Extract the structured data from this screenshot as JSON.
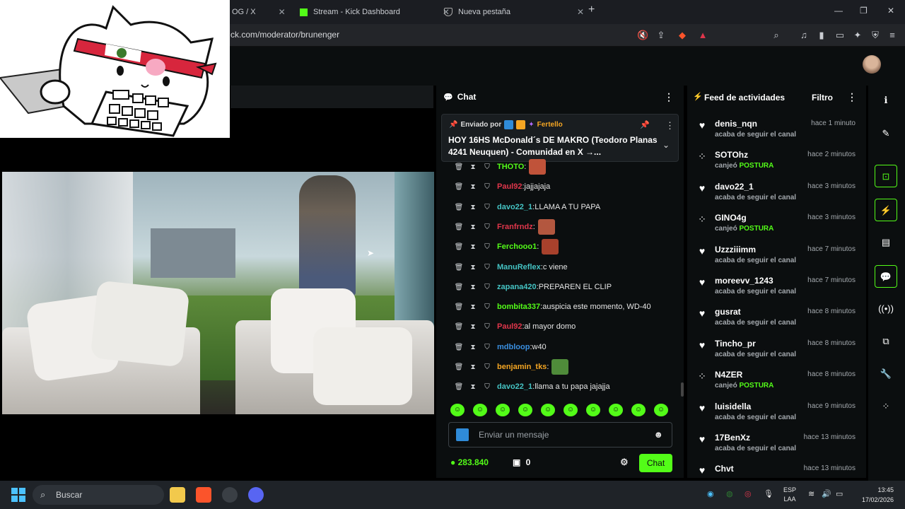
{
  "browser": {
    "tabs": [
      {
        "label": "OG / X"
      },
      {
        "label": "Stream - Kick Dashboard"
      },
      {
        "label": "Nueva pestaña"
      }
    ],
    "url": "ck.com/moderator/brunenger",
    "shield_count": "2"
  },
  "chat": {
    "title": "Chat",
    "pinned": {
      "prefix": "Enviado por",
      "user": "Fertello",
      "message": "HOY 16HS McDonald´s DE MAKRO (Teodoro Planas 4241 Neuquen) - Comunidad en X →..."
    },
    "messages": [
      {
        "user": "THOTO",
        "sep": ":",
        "text": "",
        "color": "#53fc18",
        "emote": true,
        "emote_color": "#c0533a"
      },
      {
        "user": "Paul92",
        "sep": ":",
        "text": " jajjajaja",
        "color": "#e0364b",
        "emote": false
      },
      {
        "user": "davo22_1",
        "sep": ":",
        "text": " LLAMA A TU PAPA",
        "color": "#45c4c4",
        "emote": false
      },
      {
        "user": "Franfrndz",
        "sep": ":",
        "text": "",
        "color": "#e0364b",
        "emote": true,
        "emote_color": "#b3573f"
      },
      {
        "user": "Ferchooo1",
        "sep": ":",
        "text": "",
        "color": "#53fc18",
        "emote": true,
        "emote_color": "#a8412c"
      },
      {
        "user": "ManuReflex",
        "sep": ":",
        "text": " c viene",
        "color": "#45c4c4",
        "emote": false
      },
      {
        "user": "zapana420",
        "sep": ":",
        "text": " PREPAREN EL CLIP",
        "color": "#45c4c4",
        "emote": false
      },
      {
        "user": "bombita337",
        "sep": ":",
        "text": " auspicia este momento, WD-40",
        "color": "#53fc18",
        "emote": false
      },
      {
        "user": "Paul92",
        "sep": ":",
        "text": " al mayor domo",
        "color": "#e0364b",
        "emote": false
      },
      {
        "user": "mdbloop",
        "sep": ":",
        "text": " w40",
        "color": "#3a8fe0",
        "emote": false
      },
      {
        "user": "benjamin_tks",
        "sep": ":",
        "text": "",
        "color": "#f5a623",
        "emote": true,
        "emote_color": "#4f8b3a"
      },
      {
        "user": "davo22_1",
        "sep": ":",
        "text": " llama a tu papa jajajja",
        "color": "#45c4c4",
        "emote": false
      }
    ],
    "input_placeholder": "Enviar un mensaje",
    "points": "283.840",
    "store_count": "0",
    "send_label": "Chat"
  },
  "feed": {
    "title": "Feed de actividades",
    "filter_label": "Filtro",
    "items": [
      {
        "user": "denis_nqn",
        "time": "hace 1 minuto",
        "action": "acaba de seguir el canal",
        "highlight": "",
        "type": "follow"
      },
      {
        "user": "SOTOhz",
        "time": "hace 2 minutos",
        "action": "canjeó ",
        "highlight": "POSTURA",
        "type": "redeem"
      },
      {
        "user": "davo22_1",
        "time": "hace 3 minutos",
        "action": "acaba de seguir el canal",
        "highlight": "",
        "type": "follow"
      },
      {
        "user": "GINO4g",
        "time": "hace 3 minutos",
        "action": "canjeó ",
        "highlight": "POSTURA",
        "type": "redeem"
      },
      {
        "user": "Uzzziiimm",
        "time": "hace 7 minutos",
        "action": "acaba de seguir el canal",
        "highlight": "",
        "type": "follow"
      },
      {
        "user": "moreevv_1243",
        "time": "hace 7 minutos",
        "action": "acaba de seguir el canal",
        "highlight": "",
        "type": "follow"
      },
      {
        "user": "gusrat",
        "time": "hace 8 minutos",
        "action": "acaba de seguir el canal",
        "highlight": "",
        "type": "follow"
      },
      {
        "user": "Tincho_pr",
        "time": "hace 8 minutos",
        "action": "acaba de seguir el canal",
        "highlight": "",
        "type": "follow"
      },
      {
        "user": "N4ZER",
        "time": "hace 8 minutos",
        "action": "canjeó ",
        "highlight": "POSTURA",
        "type": "redeem"
      },
      {
        "user": "luisidella",
        "time": "hace 9 minutos",
        "action": "acaba de seguir el canal",
        "highlight": "",
        "type": "follow"
      },
      {
        "user": "17BenXz",
        "time": "hace 13 minutos",
        "action": "acaba de seguir el canal",
        "highlight": "",
        "type": "follow"
      },
      {
        "user": "Chvt",
        "time": "hace 13 minutos",
        "action": "",
        "highlight": "",
        "type": "follow"
      }
    ]
  },
  "taskbar": {
    "search_placeholder": "Buscar",
    "lang_line1": "ESP",
    "lang_line2": "LAA",
    "time": "13:45",
    "date": "17/02/2026"
  },
  "colors": {
    "accent": "#53fc18",
    "background": "#0b0e0f"
  }
}
